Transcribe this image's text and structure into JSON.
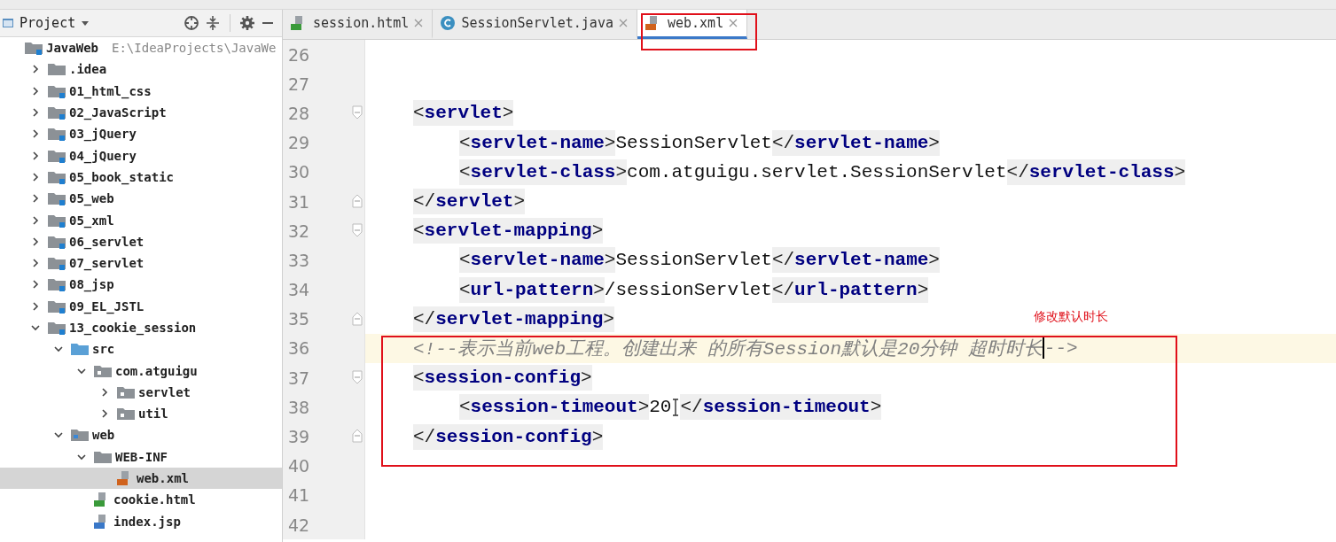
{
  "project_panel": {
    "title": "Project",
    "tree": [
      {
        "label": "JavaWeb",
        "path": "E:\\IdeaProjects\\JavaWe",
        "kind": "module",
        "selected": false,
        "children": [
          {
            "label": ".idea",
            "kind": "folder",
            "expanded": false,
            "selected": false
          },
          {
            "label": "01_html_css",
            "kind": "module",
            "expanded": false,
            "selected": false
          },
          {
            "label": "02_JavaScript",
            "kind": "module",
            "expanded": false,
            "selected": false
          },
          {
            "label": "03_jQuery",
            "kind": "module",
            "expanded": false,
            "selected": false
          },
          {
            "label": "04_jQuery",
            "kind": "module",
            "expanded": false,
            "selected": false
          },
          {
            "label": "05_book_static",
            "kind": "module",
            "expanded": false,
            "selected": false
          },
          {
            "label": "05_web",
            "kind": "module",
            "expanded": false,
            "selected": false
          },
          {
            "label": "05_xml",
            "kind": "module",
            "expanded": false,
            "selected": false
          },
          {
            "label": "06_servlet",
            "kind": "module",
            "expanded": false,
            "selected": false
          },
          {
            "label": "07_servlet",
            "kind": "module",
            "expanded": false,
            "selected": false
          },
          {
            "label": "08_jsp",
            "kind": "module",
            "expanded": false,
            "selected": false
          },
          {
            "label": "09_EL_JSTL",
            "kind": "module",
            "expanded": false,
            "selected": false
          },
          {
            "label": "13_cookie_session",
            "kind": "module",
            "expanded": true,
            "selected": false,
            "children": [
              {
                "label": "src",
                "kind": "source",
                "expanded": true,
                "selected": false,
                "children": [
                  {
                    "label": "com.atguigu",
                    "kind": "package",
                    "expanded": true,
                    "selected": false,
                    "children": [
                      {
                        "label": "servlet",
                        "kind": "package",
                        "expanded": false,
                        "selected": false
                      },
                      {
                        "label": "util",
                        "kind": "package",
                        "expanded": false,
                        "selected": false
                      }
                    ]
                  }
                ]
              },
              {
                "label": "web",
                "kind": "web",
                "expanded": true,
                "selected": false,
                "children": [
                  {
                    "label": "WEB-INF",
                    "kind": "folder",
                    "expanded": true,
                    "selected": false,
                    "children": [
                      {
                        "label": "web.xml",
                        "kind": "xml",
                        "selected": true
                      }
                    ]
                  },
                  {
                    "label": "cookie.html",
                    "kind": "html",
                    "selected": false
                  },
                  {
                    "label": "index.jsp",
                    "kind": "jsp",
                    "selected": false
                  }
                ]
              }
            ]
          }
        ]
      }
    ]
  },
  "tabs": [
    {
      "label": "session.html",
      "kind": "html",
      "selected": false
    },
    {
      "label": "SessionServlet.java",
      "kind": "java",
      "selected": false
    },
    {
      "label": "web.xml",
      "kind": "xml",
      "selected": true
    }
  ],
  "editor": {
    "lines": [
      {
        "number": "26",
        "current": false,
        "kind": "plain"
      },
      {
        "number": "27",
        "current": false,
        "kind": "plain"
      },
      {
        "number": "28",
        "current": false,
        "kind": "foldstart",
        "tokens": [
          {
            "kind": "tag",
            "text": "<servlet>"
          }
        ],
        "children": [
          {
            "number": "29",
            "current": false,
            "tokens": [
              {
                "kind": "tag",
                "text": "<servlet-name>"
              },
              {
                "kind": "text",
                "text": "SessionServlet"
              },
              {
                "kind": "tag",
                "text": "</servlet-name>"
              }
            ]
          },
          {
            "number": "30",
            "current": false,
            "tokens": [
              {
                "kind": "tag",
                "text": "<servlet-class>"
              },
              {
                "kind": "text",
                "text": "com.atguigu.servlet.SessionServlet"
              },
              {
                "kind": "tag",
                "text": "</servlet-class>"
              }
            ]
          }
        ]
      },
      {
        "number": "31",
        "current": false,
        "kind": "foldend",
        "tokens": [
          {
            "kind": "tag",
            "text": "</servlet>"
          }
        ]
      },
      {
        "number": "32",
        "current": false,
        "kind": "foldstart",
        "tokens": [
          {
            "kind": "tag",
            "text": "<servlet-mapping>"
          }
        ],
        "children": [
          {
            "number": "33",
            "current": false,
            "tokens": [
              {
                "kind": "tag",
                "text": "<servlet-name>"
              },
              {
                "kind": "text",
                "text": "SessionServlet"
              },
              {
                "kind": "tag",
                "text": "</servlet-name>"
              }
            ]
          },
          {
            "number": "34",
            "current": false,
            "tokens": [
              {
                "kind": "tag",
                "text": "<url-pattern>"
              },
              {
                "kind": "text",
                "text": "/sessionServlet"
              },
              {
                "kind": "tag",
                "text": "</url-pattern>"
              }
            ]
          }
        ]
      },
      {
        "number": "35",
        "current": false,
        "kind": "foldend",
        "tokens": [
          {
            "kind": "tag",
            "text": "</servlet-mapping>"
          }
        ]
      },
      {
        "number": "36",
        "current": true,
        "tokens": [
          {
            "kind": "comment",
            "text": "<!--表示当前web工程。创建出来 的所有Session默认是20分钟 超时时长"
          },
          {
            "kind": "caret"
          },
          {
            "kind": "comment",
            "text": "-->"
          }
        ]
      },
      {
        "number": "37",
        "current": false,
        "kind": "foldstart",
        "tokens": [
          {
            "kind": "tag",
            "text": "<session-config>"
          }
        ],
        "children": [
          {
            "number": "38",
            "current": false,
            "tokens": [
              {
                "kind": "tag",
                "text": "<session-timeout>"
              },
              {
                "kind": "text",
                "text": "20"
              },
              {
                "kind": "pointer"
              },
              {
                "kind": "tag",
                "text": "</session-timeout>"
              }
            ]
          }
        ]
      },
      {
        "number": "39",
        "current": false,
        "kind": "foldend",
        "tokens": [
          {
            "kind": "tag",
            "text": "</session-config>"
          }
        ]
      },
      {
        "number": "40",
        "current": false,
        "kind": "plain"
      },
      {
        "number": "41",
        "current": false,
        "kind": "plain"
      },
      {
        "number": "42",
        "current": false,
        "kind": "plain"
      }
    ]
  },
  "annotation": {
    "note": "修改默认时长"
  }
}
